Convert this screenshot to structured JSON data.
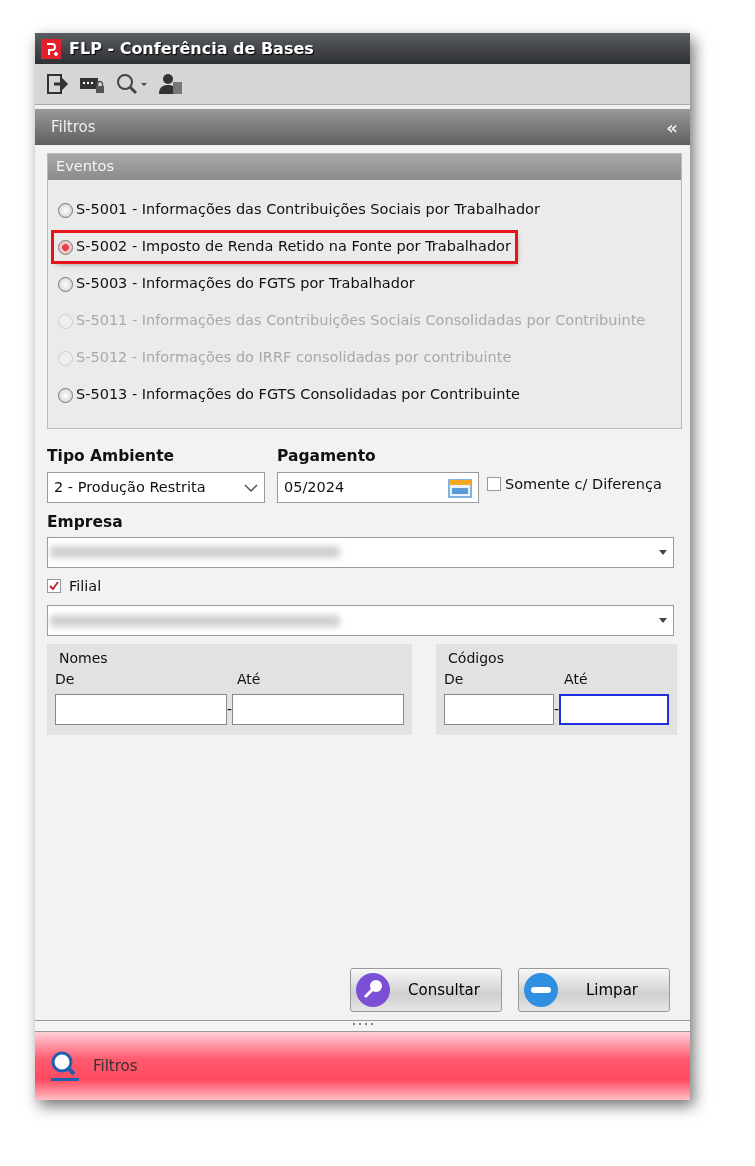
{
  "window": {
    "title": "FLP - Conferência de Bases"
  },
  "toolbar": [
    {
      "kind": "exit"
    },
    {
      "kind": "keyboard-lock"
    },
    {
      "kind": "search-dropdown"
    },
    {
      "kind": "user"
    }
  ],
  "panel": {
    "title": "Filtros",
    "collapse": "«"
  },
  "eventos": {
    "title": "Eventos",
    "options": [
      {
        "label": "S-5001 - Informações das Contribuições Sociais por Trabalhador",
        "selected": false,
        "disabled": false,
        "highlighted": false
      },
      {
        "label": "S-5002 - Imposto de Renda Retido na Fonte por Trabalhador",
        "selected": true,
        "disabled": false,
        "highlighted": true
      },
      {
        "label": "S-5003 - Informações do FGTS por Trabalhador",
        "selected": false,
        "disabled": false,
        "highlighted": false
      },
      {
        "label": "S-5011 - Informações das Contribuições Sociais Consolidadas por Contribuinte",
        "selected": false,
        "disabled": true,
        "highlighted": false
      },
      {
        "label": "S-5012 - Informações do IRRF consolidadas por contribuinte",
        "selected": false,
        "disabled": true,
        "highlighted": false
      },
      {
        "label": "S-5013 - Informações do FGTS Consolidadas por Contribuinte",
        "selected": false,
        "disabled": false,
        "highlighted": false
      }
    ]
  },
  "tipo_ambiente": {
    "label": "Tipo Ambiente",
    "value": "2 - Produção Restrita"
  },
  "pagamento": {
    "label": "Pagamento",
    "value": "05/2024"
  },
  "somente_diferenca": {
    "label": "Somente c/ Diferença",
    "checked": false
  },
  "empresa": {
    "label": "Empresa",
    "value_redacted": true
  },
  "filial": {
    "label": "Filial",
    "checked": true,
    "value_redacted": true
  },
  "nomes": {
    "title": "Nomes",
    "from_label": "De",
    "to_label": "Até",
    "separator": "-",
    "from_focused": false,
    "to_focused": false
  },
  "codigos": {
    "title": "Códigos",
    "from_label": "De",
    "to_label": "Até",
    "separator": "-",
    "from_focused": false,
    "to_focused": true
  },
  "buttons": [
    {
      "kind": "search",
      "label": "Consultar"
    },
    {
      "kind": "clear",
      "label": "Limpar"
    }
  ],
  "bottom_tab": {
    "label": "Filtros"
  }
}
